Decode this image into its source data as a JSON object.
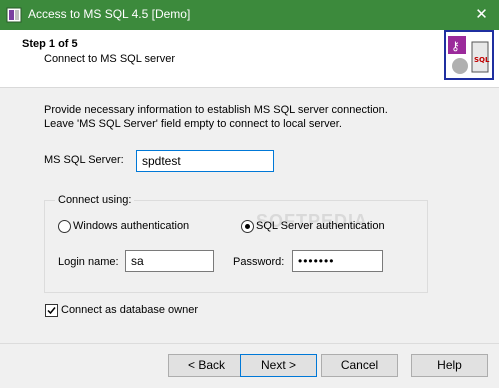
{
  "window": {
    "title": "Access to MS SQL 4.5 [Demo]",
    "close_glyph": "✕"
  },
  "header": {
    "step": "Step 1 of 5",
    "subtitle": "Connect to MS SQL server",
    "logo_icon": "db-converter-logo-icon"
  },
  "main": {
    "intro_line1": "Provide necessary information to establish MS SQL server connection.",
    "intro_line2": "Leave 'MS SQL Server' field empty to connect to local server.",
    "server_label": "MS SQL Server:",
    "server_value": "spdtest",
    "connect_using": {
      "title": "Connect using:",
      "windows_auth_label": "Windows authentication",
      "windows_auth_checked": false,
      "sql_auth_label": "SQL Server authentication",
      "sql_auth_checked": true,
      "login_label": "Login name:",
      "login_value": "sa",
      "password_label": "Password:",
      "password_value": "•••••••"
    },
    "db_owner_label": "Connect as database owner",
    "db_owner_checked": true,
    "watermark": "SOFTPEDIA"
  },
  "footer": {
    "back_label": "< Back",
    "next_label": "Next >",
    "cancel_label": "Cancel",
    "help_label": "Help"
  },
  "colors": {
    "titlebar": "#3c8a3c",
    "focus_blue": "#0078d7",
    "logo_border": "#1f2fa0"
  }
}
